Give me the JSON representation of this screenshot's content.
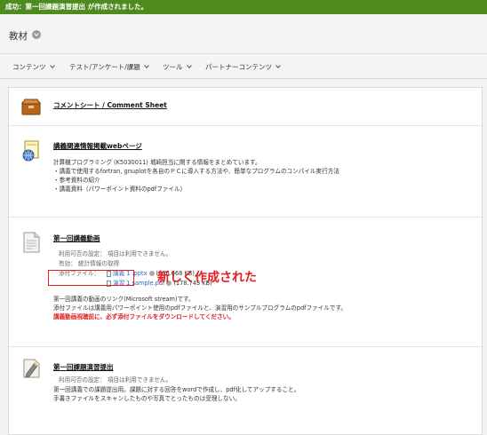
{
  "success_message": "成功：第一回課題演習提出 が作成されました。",
  "page": {
    "title": "教材"
  },
  "nav": {
    "items": [
      {
        "label": "コンテンツ"
      },
      {
        "label": "テスト/アンケート/課題"
      },
      {
        "label": "ツール"
      },
      {
        "label": "パートナーコンテンツ"
      }
    ]
  },
  "items": [
    {
      "icon": "folder-icon",
      "title": "コメントシート / Comment Sheet"
    },
    {
      "icon": "web-link-icon",
      "title": "講義関連情報掲載webページ",
      "lines": [
        "計算機プログラミング (K5030011) 城崎担当に関する情報をまとめています。",
        "・講義で使用するfortran, gnuplotを各自のＰＣに導入する方法や、簡単なプログラムのコンパイル実行方法",
        "・参考資料の紹介",
        "・講義資料（パワーポイント資料のpdfファイル）"
      ]
    },
    {
      "icon": "document-icon",
      "title": "第一回講義動画",
      "availability": "利用可否の設定：  項目は利用できません。",
      "tracking": "有効：  統計情報の取得",
      "attach_label": "添付ファイル：",
      "attachments": [
        {
          "name": "講義 1 .pptx",
          "size": "(336.668 KB)"
        },
        {
          "name": "演習 1 sample.pdf",
          "size": "(178.743 KB)"
        }
      ],
      "lines": [
        "第一回講義の動画のリンク(Microsoft stream)です。",
        "添付ファイルは講義用パワーポイント使用のpdfファイルと、演習用のサンプルプログラムのpdfファイルです。"
      ],
      "warning": "講義動画視聴前に、必ず添付ファイルをダウンロードしてください。"
    },
    {
      "icon": "assignment-icon",
      "title": "第一回課題演習提出",
      "availability": "利用可否の設定：  項目は利用できません。",
      "lines": [
        "第一回講義での課題提出用。課題に対する回答をwordで作成し、pdf化してアップすること。",
        "手書きファイルをスキャンしたものや写真でとったものは受理しない。"
      ]
    }
  ],
  "annotation": "新しく作成された",
  "colors": {
    "success": "#4f8a1e",
    "accent_red": "#e02020",
    "link": "#2a66b8"
  }
}
